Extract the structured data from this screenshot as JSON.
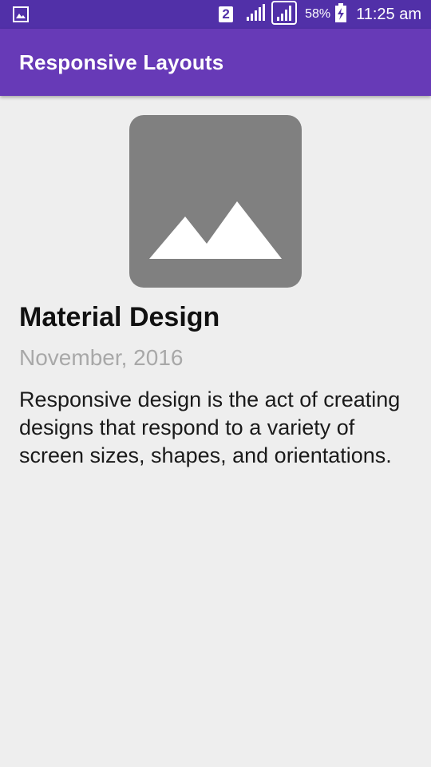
{
  "status_bar": {
    "sim_slot": "2",
    "battery_percent": "58%",
    "time": "11:25 am",
    "icons": [
      "gallery-icon",
      "sim-icon",
      "signal-icon",
      "signal-outline-icon",
      "battery-charging-icon"
    ]
  },
  "app_bar": {
    "title": "Responsive Layouts",
    "color": "#673ab7"
  },
  "article": {
    "image_icon": "image-placeholder-icon",
    "title": "Material Design",
    "date": "November, 2016",
    "body": "Responsive design is the act of creating designs that respond to a variety of screen sizes, shapes, and orientations."
  }
}
